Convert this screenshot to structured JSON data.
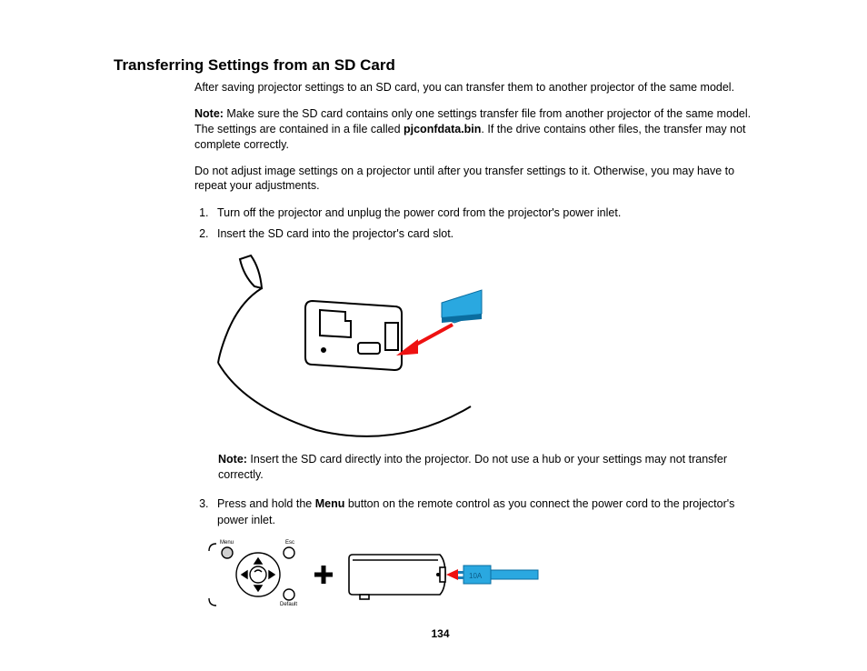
{
  "page": {
    "title": "Transferring Settings from an SD Card",
    "intro": "After saving projector settings to an SD card, you can transfer them to another projector of the same model.",
    "note1_label": "Note:",
    "note1_a": " Make sure the SD card contains only one settings transfer file from another projector of the same model. The settings are contained in a file called ",
    "note1_file": "pjconfdata.bin",
    "note1_b": ". If the drive contains other files, the transfer may not complete correctly.",
    "warn": "Do not adjust image settings on a projector until after you transfer settings to it. Otherwise, you may have to repeat your adjustments.",
    "steps": {
      "s1": "Turn off the projector and unplug the power cord from the projector's power inlet.",
      "s2": "Insert the SD card into the projector's card slot.",
      "s3a": "Press and hold the ",
      "s3_menu": "Menu",
      "s3b": " button on the remote control as you connect the power cord to the projector's power inlet."
    },
    "note2_label": "Note:",
    "note2_text": " Insert the SD card directly into the projector. Do not use a hub or your settings may not transfer correctly.",
    "remote_labels": {
      "menu": "Menu",
      "esc": "Esc",
      "default": "Default"
    },
    "page_number": "134"
  }
}
